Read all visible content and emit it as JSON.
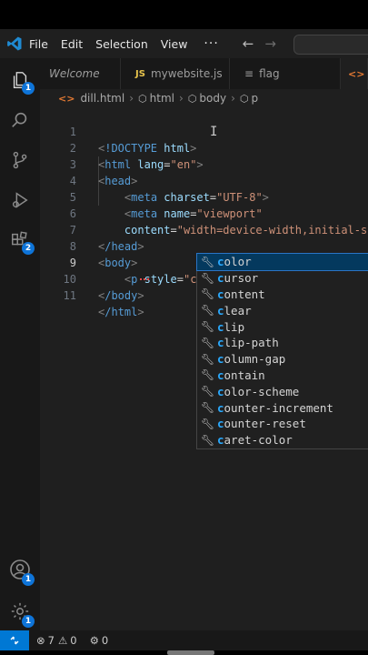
{
  "menu": {
    "file": "File",
    "edit": "Edit",
    "selection": "Selection",
    "view": "View",
    "more": "···"
  },
  "activity": {
    "explorer_badge": "1",
    "extensions_badge": "2",
    "accounts_badge": "1",
    "settings_badge": "1"
  },
  "tabs": [
    {
      "label": "Welcome"
    },
    {
      "label": "mywebsite.js",
      "icon_text": "JS"
    },
    {
      "label": "flag"
    },
    {
      "label": ""
    }
  ],
  "breadcrumb": {
    "file": "dill.html",
    "items": [
      "html",
      "body",
      "p"
    ]
  },
  "editor": {
    "lines": [
      {
        "n": "1"
      },
      {
        "n": "2"
      },
      {
        "n": "3"
      },
      {
        "n": "4"
      },
      {
        "n": "5"
      },
      {
        "n": "6"
      },
      {
        "n": "7"
      },
      {
        "n": "8"
      },
      {
        "n": "9"
      },
      {
        "n": "10"
      },
      {
        "n": "11"
      }
    ],
    "doctype_kw": "!DOCTYPE",
    "doctype_html": "html",
    "html_tag": "html",
    "lang_attr": "lang",
    "lang_val": "\"en\"",
    "head_tag": "head",
    "meta_tag": "meta",
    "charset_attr": "charset",
    "charset_val": "\"UTF-8\"",
    "name_attr": "name",
    "name_val": "\"viewport\"",
    "content_attr": "content",
    "content_val": "\"width=device-width,initial-s",
    "head_close": "/head",
    "body_tag": "body",
    "p_tag": "p",
    "style_attr": "style",
    "style_val": "\"c",
    "body_close": "/body",
    "html_close": "/html"
  },
  "suggestions": [
    {
      "hl": "c",
      "rest": "olor"
    },
    {
      "hl": "c",
      "rest": "ursor"
    },
    {
      "hl": "c",
      "rest": "ontent"
    },
    {
      "hl": "c",
      "rest": "lear"
    },
    {
      "hl": "c",
      "rest": "lip"
    },
    {
      "hl": "c",
      "rest": "lip-path"
    },
    {
      "hl": "c",
      "rest": "olumn-gap"
    },
    {
      "hl": "c",
      "rest": "ontain"
    },
    {
      "hl": "c",
      "rest": "olor-scheme"
    },
    {
      "hl": "c",
      "rest": "ounter-increment"
    },
    {
      "hl": "c",
      "rest": "ounter-reset"
    },
    {
      "hl": "c",
      "rest": "aret-color"
    }
  ],
  "status": {
    "errors": "7",
    "warnings": "0",
    "ports": "0"
  },
  "colors": {
    "accent": "#0078d4",
    "selection": "#04395e"
  }
}
